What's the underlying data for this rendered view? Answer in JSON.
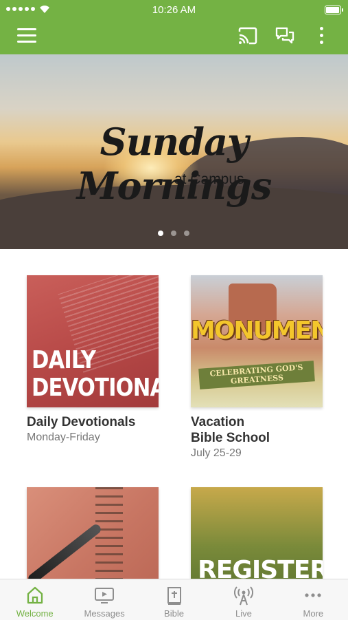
{
  "status_bar": {
    "time": "10:26 AM"
  },
  "hero": {
    "title": "Sunday Mornings",
    "subtitle": "at Campus",
    "pages": 3,
    "active_page": 1
  },
  "cards": [
    {
      "title": "Daily Devotionals",
      "subtitle": "Monday-Friday",
      "image_text": "DAILY DEVOTIONALS"
    },
    {
      "title": "Vacation\nBible School",
      "subtitle": "July 25-29",
      "image_text": "MONUMENTAL",
      "image_tagline": "CELEBRATING GOD'S GREATNESS"
    },
    {
      "title": "",
      "subtitle": ""
    },
    {
      "title": "",
      "subtitle": "",
      "image_text": "REGISTER"
    }
  ],
  "tabs": [
    {
      "label": "Welcome",
      "icon": "home-icon",
      "active": true
    },
    {
      "label": "Messages",
      "icon": "tv-icon",
      "active": false
    },
    {
      "label": "Bible",
      "icon": "bible-icon",
      "active": false
    },
    {
      "label": "Live",
      "icon": "broadcast-icon",
      "active": false
    },
    {
      "label": "More",
      "icon": "more-horizontal-icon",
      "active": false
    }
  ],
  "colors": {
    "brand": "#74b244",
    "tab_inactive": "#8e8e8e"
  }
}
